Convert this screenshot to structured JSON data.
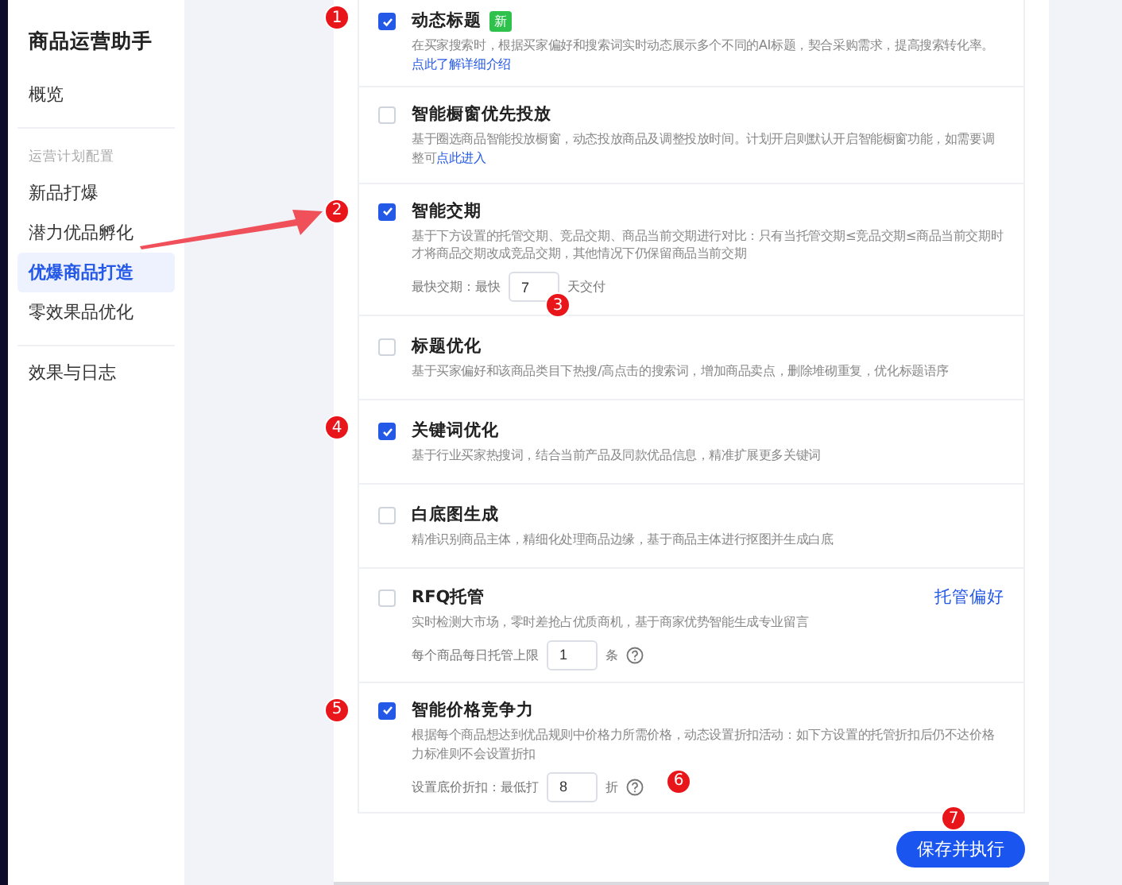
{
  "sidebar": {
    "title": "商品运营助手",
    "groups": [
      {
        "items": [
          {
            "label": "概览",
            "selected": false
          }
        ]
      },
      {
        "heading": "运营计划配置",
        "items": [
          {
            "label": "新品打爆",
            "selected": false
          },
          {
            "label": "潜力优品孵化",
            "selected": false
          },
          {
            "label": "优爆商品打造",
            "selected": true
          },
          {
            "label": "零效果品优化",
            "selected": false
          }
        ]
      },
      {
        "items": [
          {
            "label": "效果与日志",
            "selected": false
          }
        ]
      }
    ]
  },
  "options": [
    {
      "title": "动态标题",
      "checked": true,
      "marker": "1",
      "badge": "新",
      "description": "在买家搜索时，根据买家偏好和搜索词实时动态展示多个不同的AI标题，契合采购需求，提高搜索转化率。",
      "link": "点此了解详细介绍"
    },
    {
      "title": "智能橱窗优先投放",
      "checked": false,
      "description": "基于圈选商品智能投放橱窗，动态投放商品及调整投放时间。计划开启则默认开启智能橱窗功能，如需要调整可",
      "link": "点此进入"
    },
    {
      "title": "智能交期",
      "checked": true,
      "marker": "2",
      "description": "基于下方设置的托管交期、竞品交期、商品当前交期进行对比：只有当托管交期≤竞品交期≤商品当前交期时才将商品交期改成竞品交期，其他情况下仍保留商品当前交期",
      "setting": {
        "label": "最快交期：最快",
        "value": "7",
        "unit": "天交付",
        "marker": "3"
      }
    },
    {
      "title": "标题优化",
      "checked": false,
      "description": "基于买家偏好和该商品类目下热搜/高点击的搜索词，增加商品卖点，删除堆砌重复，优化标题语序"
    },
    {
      "title": "关键词优化",
      "checked": true,
      "marker": "4",
      "description": "基于行业买家热搜词，结合当前产品及同款优品信息，精准扩展更多关键词"
    },
    {
      "title": "白底图生成",
      "checked": false,
      "description": "精准识别商品主体，精细化处理商品边缘，基于商品主体进行抠图并生成白底"
    },
    {
      "title": "RFQ托管",
      "checked": false,
      "action": "托管偏好",
      "description": "实时检测大市场，零时差抢占优质商机，基于商家优势智能生成专业留言",
      "setting": {
        "label": "每个商品每日托管上限",
        "value": "1",
        "unit": "条",
        "help": true
      }
    },
    {
      "title": "智能价格竞争力",
      "checked": true,
      "marker": "5",
      "description": "根据每个商品想达到优品规则中价格力所需价格，动态设置折扣活动：如下方设置的托管折扣后仍不达价格力标准则不会设置折扣",
      "setting": {
        "label": "设置底价折扣：最低打",
        "value": "8",
        "unit": "折",
        "help": true,
        "marker": "6"
      }
    }
  ],
  "save_button": {
    "label": "保存并执行",
    "marker": "7"
  }
}
